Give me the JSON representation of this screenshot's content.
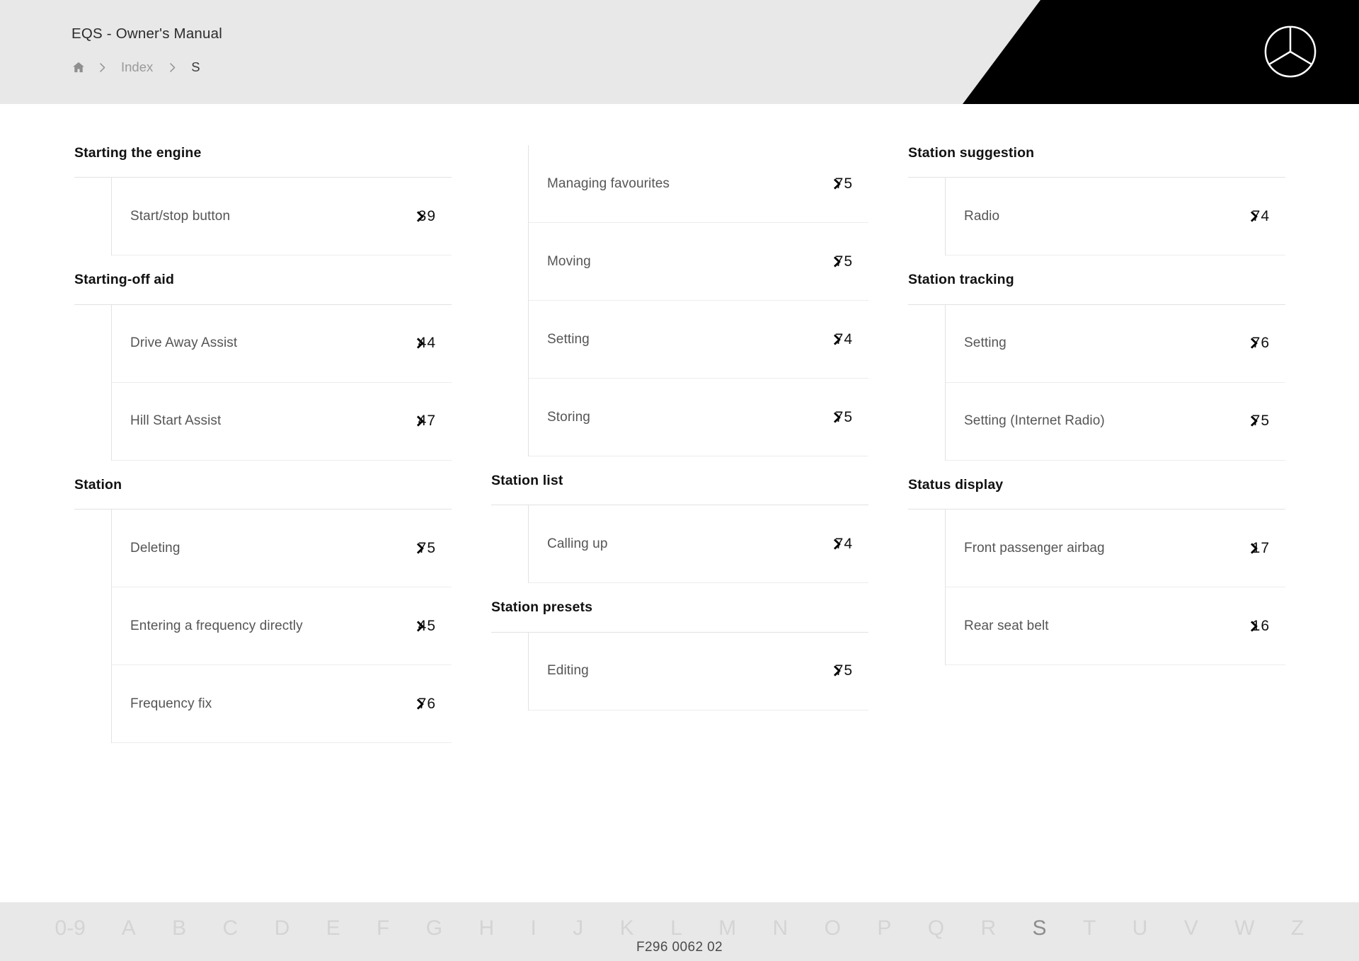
{
  "header": {
    "manual_title": "EQS - Owner's Manual",
    "breadcrumb": {
      "home_icon": "home-icon",
      "separator": "chevron-right-icon",
      "items": [
        {
          "label": "Index",
          "current": false
        },
        {
          "label": "S",
          "current": true
        }
      ]
    },
    "logo": "mercedes-benz-star-logo",
    "colors": {
      "band_background": "#e8e8e8",
      "logo_panel_background": "#000000",
      "logo_stroke": "#ffffff"
    }
  },
  "index": {
    "columns": [
      {
        "groups": [
          {
            "heading": "Starting the engine",
            "entries": [
              {
                "label": "Start/stop button",
                "page": "39"
              }
            ]
          },
          {
            "heading": "Starting-off aid",
            "entries": [
              {
                "label": "Drive Away Assist",
                "page": "44"
              },
              {
                "label": "Hill Start Assist",
                "page": "47"
              }
            ]
          },
          {
            "heading": "Station",
            "entries": [
              {
                "label": "Deleting",
                "page": "75"
              },
              {
                "label": "Entering a frequency directly",
                "page": "45"
              },
              {
                "label": "Frequency fix",
                "page": "76"
              }
            ]
          }
        ]
      },
      {
        "groups": [
          {
            "heading": "",
            "continued": true,
            "entries": [
              {
                "label": "Managing favourites",
                "page": "75"
              },
              {
                "label": "Moving",
                "page": "75"
              },
              {
                "label": "Setting",
                "page": "74"
              },
              {
                "label": "Storing",
                "page": "75"
              }
            ]
          },
          {
            "heading": "Station list",
            "entries": [
              {
                "label": "Calling up",
                "page": "74"
              }
            ]
          },
          {
            "heading": "Station presets",
            "entries": [
              {
                "label": "Editing",
                "page": "75"
              }
            ]
          }
        ]
      },
      {
        "groups": [
          {
            "heading": "Station suggestion",
            "entries": [
              {
                "label": "Radio",
                "page": "74"
              }
            ]
          },
          {
            "heading": "Station tracking",
            "entries": [
              {
                "label": "Setting",
                "page": "76"
              },
              {
                "label": "Setting (Internet Radio)",
                "page": "75"
              }
            ]
          },
          {
            "heading": "Status display",
            "entries": [
              {
                "label": "Front passenger airbag",
                "page": "17"
              },
              {
                "label": "Rear seat belt",
                "page": "16"
              }
            ]
          }
        ]
      }
    ]
  },
  "alphabet_bar": {
    "letters": [
      {
        "label": "0-9",
        "active": false
      },
      {
        "label": "A",
        "active": false
      },
      {
        "label": "B",
        "active": false
      },
      {
        "label": "C",
        "active": false
      },
      {
        "label": "D",
        "active": false
      },
      {
        "label": "E",
        "active": false
      },
      {
        "label": "F",
        "active": false
      },
      {
        "label": "G",
        "active": false
      },
      {
        "label": "H",
        "active": false
      },
      {
        "label": "I",
        "active": false
      },
      {
        "label": "J",
        "active": false
      },
      {
        "label": "K",
        "active": false
      },
      {
        "label": "L",
        "active": false
      },
      {
        "label": "M",
        "active": false
      },
      {
        "label": "N",
        "active": false
      },
      {
        "label": "O",
        "active": false
      },
      {
        "label": "P",
        "active": false
      },
      {
        "label": "Q",
        "active": false
      },
      {
        "label": "R",
        "active": false
      },
      {
        "label": "S",
        "active": true
      },
      {
        "label": "T",
        "active": false
      },
      {
        "label": "U",
        "active": false
      },
      {
        "label": "V",
        "active": false
      },
      {
        "label": "W",
        "active": false
      },
      {
        "label": "Z",
        "active": false
      }
    ],
    "background": "#e8e8e8",
    "inactive_color": "#d4d4d4",
    "active_color": "#8d8d8d"
  },
  "footer": {
    "document_code": "F296 0062 02"
  }
}
